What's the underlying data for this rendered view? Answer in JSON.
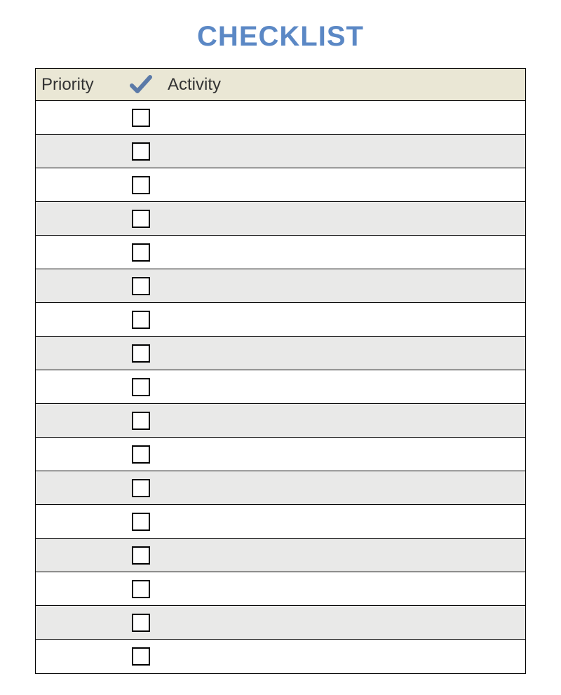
{
  "title": "CHECKLIST",
  "columns": {
    "priority": "Priority",
    "activity": "Activity"
  },
  "rows": [
    {
      "priority": "",
      "checked": false,
      "activity": ""
    },
    {
      "priority": "",
      "checked": false,
      "activity": ""
    },
    {
      "priority": "",
      "checked": false,
      "activity": ""
    },
    {
      "priority": "",
      "checked": false,
      "activity": ""
    },
    {
      "priority": "",
      "checked": false,
      "activity": ""
    },
    {
      "priority": "",
      "checked": false,
      "activity": ""
    },
    {
      "priority": "",
      "checked": false,
      "activity": ""
    },
    {
      "priority": "",
      "checked": false,
      "activity": ""
    },
    {
      "priority": "",
      "checked": false,
      "activity": ""
    },
    {
      "priority": "",
      "checked": false,
      "activity": ""
    },
    {
      "priority": "",
      "checked": false,
      "activity": ""
    },
    {
      "priority": "",
      "checked": false,
      "activity": ""
    },
    {
      "priority": "",
      "checked": false,
      "activity": ""
    },
    {
      "priority": "",
      "checked": false,
      "activity": ""
    },
    {
      "priority": "",
      "checked": false,
      "activity": ""
    },
    {
      "priority": "",
      "checked": false,
      "activity": ""
    },
    {
      "priority": "",
      "checked": false,
      "activity": ""
    }
  ]
}
